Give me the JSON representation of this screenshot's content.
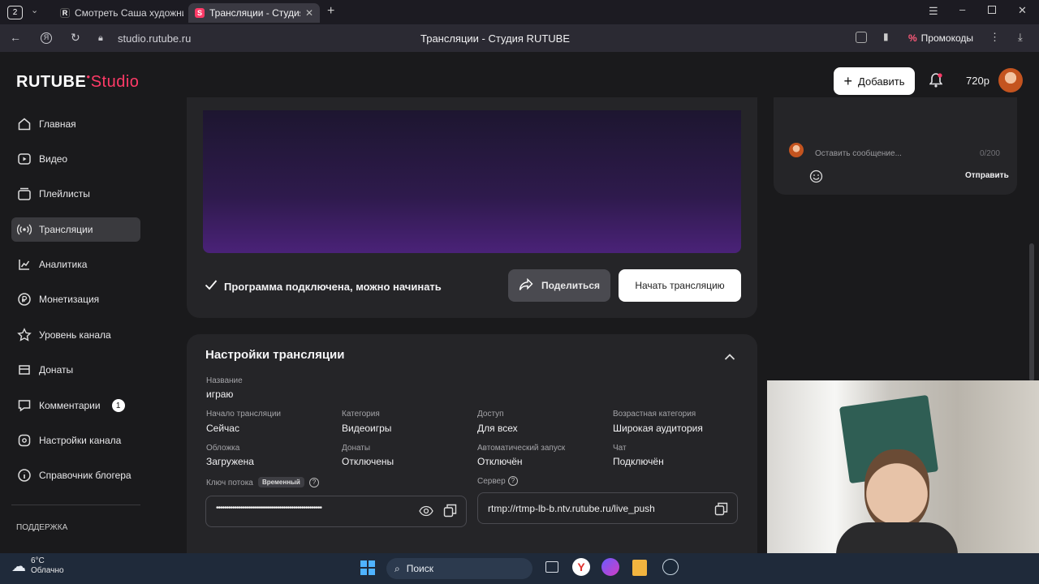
{
  "browser": {
    "tab_count": "2",
    "tabs": [
      {
        "label": "Смотреть Саша художни",
        "favicon": "R",
        "active": false
      },
      {
        "label": "Трансляции - Студия R",
        "favicon": "S",
        "active": true
      }
    ],
    "url": "studio.rutube.ru",
    "page_title": "Трансляции - Студия RUTUBE",
    "promo_label": "Промокоды"
  },
  "header": {
    "logo_main": "RUTUBE",
    "logo_studio": "Studio",
    "add_label": "Добавить",
    "quality": "720p"
  },
  "sidebar": {
    "items": [
      {
        "label": "Главная",
        "icon": "home-icon"
      },
      {
        "label": "Видео",
        "icon": "video-icon"
      },
      {
        "label": "Плейлисты",
        "icon": "playlist-icon"
      },
      {
        "label": "Трансляции",
        "icon": "broadcast-icon",
        "active": true
      },
      {
        "label": "Аналитика",
        "icon": "analytics-icon"
      },
      {
        "label": "Монетизация",
        "icon": "money-icon"
      },
      {
        "label": "Уровень канала",
        "icon": "star-icon"
      },
      {
        "label": "Донаты",
        "icon": "donate-icon"
      },
      {
        "label": "Комментарии",
        "icon": "comment-icon",
        "badge": "1"
      },
      {
        "label": "Настройки канала",
        "icon": "settings-icon"
      },
      {
        "label": "Справочник блогера",
        "icon": "info-icon"
      }
    ],
    "support_label": "ПОДДЕРЖКА"
  },
  "stream": {
    "status": "Программа подключена, можно начинать",
    "share_label": "Поделиться",
    "start_label": "Начать трансляцию"
  },
  "chat": {
    "placeholder": "Оставить сообщение...",
    "counter": "0/200",
    "send_label": "Отправить"
  },
  "settings": {
    "title": "Настройки трансляции",
    "name_label": "Название",
    "name_value": "играю",
    "fields": [
      {
        "label": "Начало трансляции",
        "value": "Сейчас"
      },
      {
        "label": "Категория",
        "value": "Видеоигры"
      },
      {
        "label": "Доступ",
        "value": "Для всех"
      },
      {
        "label": "Возрастная категория",
        "value": "Широкая аудитория"
      },
      {
        "label": "Обложка",
        "value": "Загружена"
      },
      {
        "label": "Донаты",
        "value": "Отключены"
      },
      {
        "label": "Автоматический запуск",
        "value": "Отключён"
      },
      {
        "label": "Чат",
        "value": "Подключён"
      }
    ],
    "key_label": "Ключ потока",
    "key_badge": "Временный",
    "key_value": "••••••••••••••••••••••••••••••••••••••••••••••••••••",
    "server_label": "Сервер",
    "server_value": "rtmp://rtmp-lb-b.ntv.rutube.ru/live_push"
  },
  "taskbar": {
    "temp": "6°C",
    "weather": "Облачно",
    "search": "Поиск"
  },
  "colors": {
    "accent": "#ff3a67",
    "bg": "#1a1a1c",
    "card": "#252528"
  }
}
